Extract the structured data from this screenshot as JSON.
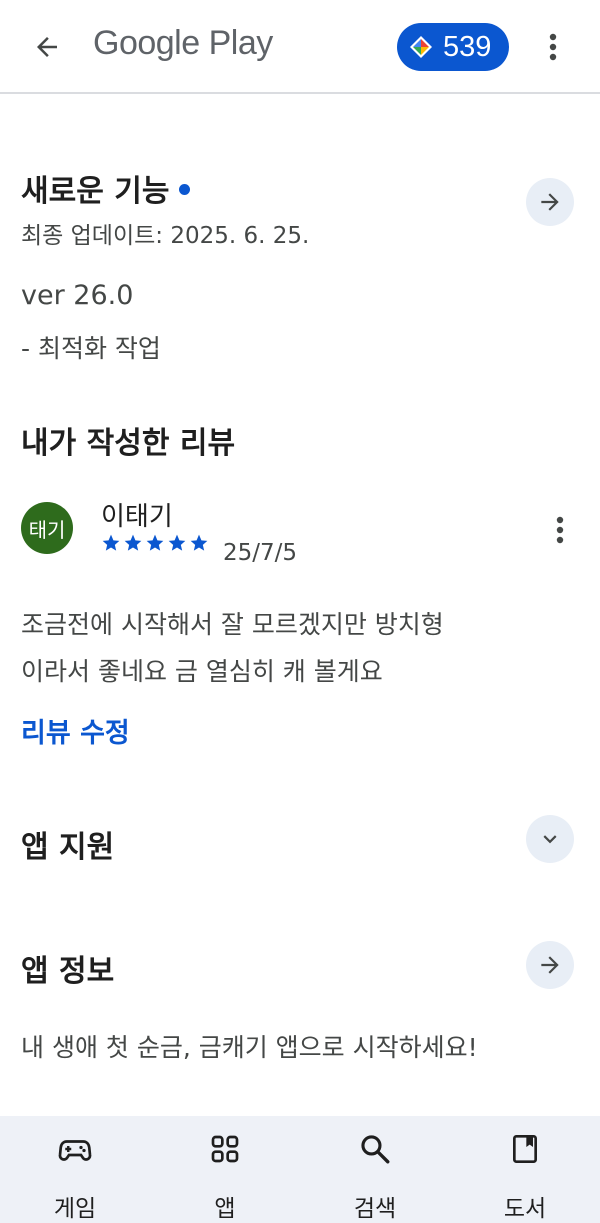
{
  "header": {
    "brand": "Google Play",
    "points": "539"
  },
  "whats_new": {
    "title": "새로운 기능",
    "updated": "최종 업데이트: 2025. 6. 25.",
    "version": "ver 26.0",
    "note": "- 최적화 작업"
  },
  "my_review": {
    "section_title": "내가 작성한 리뷰",
    "avatar_text": "태기",
    "author": "이태기",
    "rating": 5,
    "date": "25/7/5",
    "text_line1": "조금전에 시작해서 잘 모르겠지만 방치형",
    "text_line2": "이라서 좋네요 금 열심히 캐 볼게요",
    "edit_label": "리뷰 수정"
  },
  "app_support": {
    "title": "앱 지원"
  },
  "app_info": {
    "title": "앱 정보",
    "description": "내 생애 첫 순금, 금캐기 앱으로 시작하세요!"
  },
  "bottom_nav": {
    "items": [
      {
        "label": "게임",
        "icon": "gamepad-icon"
      },
      {
        "label": "앱",
        "icon": "apps-grid-icon"
      },
      {
        "label": "검색",
        "icon": "search-icon"
      },
      {
        "label": "도서",
        "icon": "book-icon"
      }
    ]
  },
  "colors": {
    "accent": "#0b57d0",
    "avatar_bg": "#2e6b1c",
    "circle_btn_bg": "#e8eef6",
    "nav_bg": "#eef1f7"
  }
}
